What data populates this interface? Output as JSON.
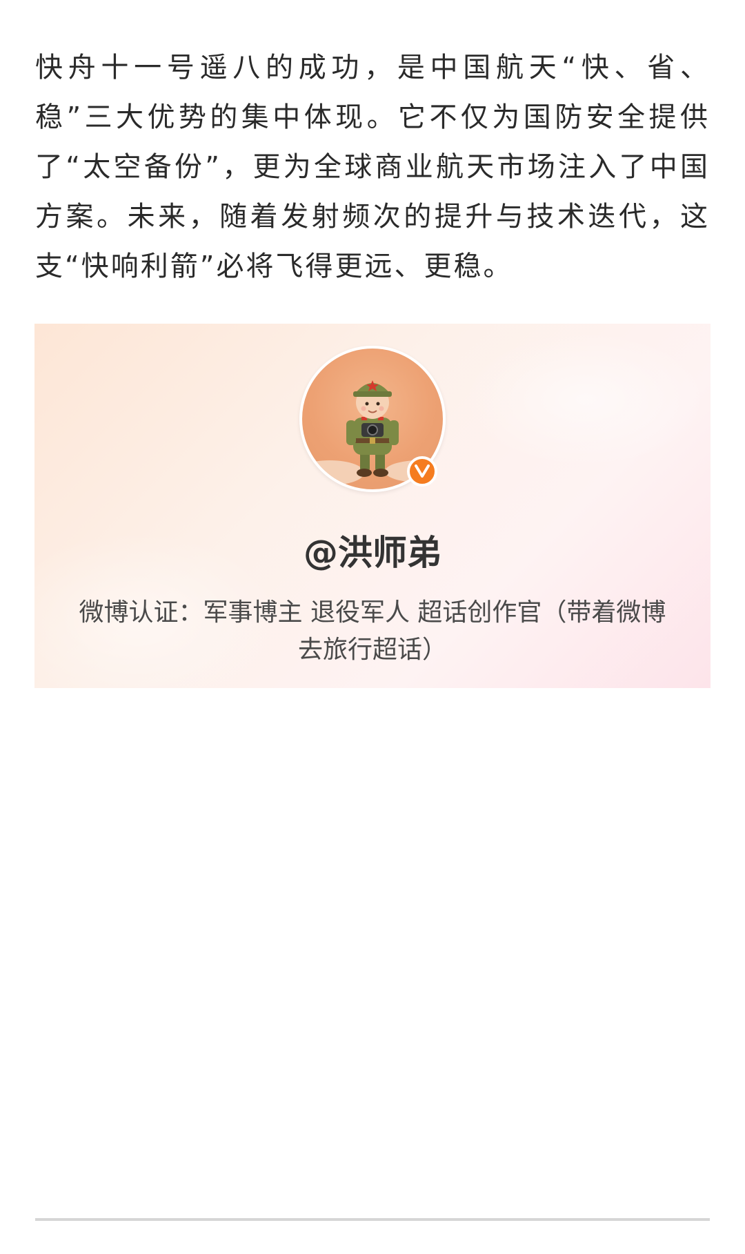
{
  "article": {
    "paragraph": "快舟十一号遥八的成功，是中国航天“快、省、稳”三大优势的集中体现。它不仅为国防安全提供了“太空备份”，更为全球商业航天市场注入了中国方案。未来，随着发射频次的提升与技术迭代，这支“快响利箭”必将飞得更远、更稳。"
  },
  "profile_card": {
    "avatar_icon": "soldier-avatar",
    "verified_icon": "verified-v-icon",
    "verified_color": "#f57c1f",
    "username": "@洪师弟",
    "verification": "微博认证：军事博主 退役军人 超话创作官（带着微博去旅行超话）"
  }
}
